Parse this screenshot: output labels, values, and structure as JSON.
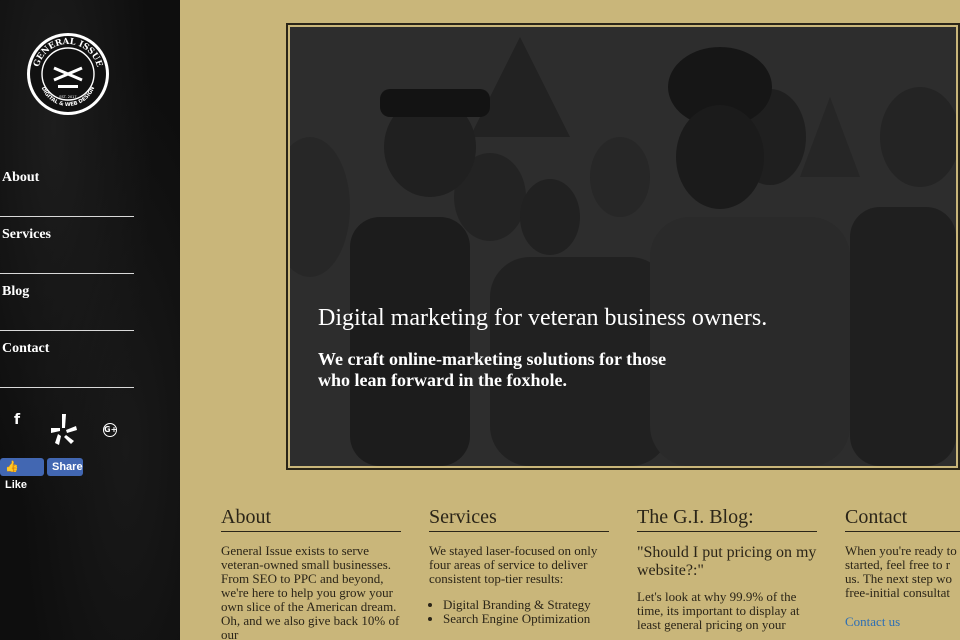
{
  "brand": {
    "logo_top_text": "GENERAL ISSUE",
    "logo_bottom_text": "DIGITAL & WEB DESIGN",
    "logo_est": "EST. 2017"
  },
  "nav": {
    "items": [
      "About",
      "Services",
      "Blog",
      "Contact"
    ]
  },
  "social": {
    "facebook_icon": "f",
    "yelp_icon": "yelp-icon",
    "gplus_icon": "G+"
  },
  "fb": {
    "like_label": "Like",
    "share_label": "Share"
  },
  "hero": {
    "title": "Digital marketing for veteran business owners.",
    "subtitle_line1": "We craft online-marketing solutions for those",
    "subtitle_line2": "who lean forward in the foxhole."
  },
  "about": {
    "heading": "About",
    "text": "General Issue exists to serve veteran-owned small businesses. From SEO to PPC and beyond, we're here to help you grow your own slice of the American dream. Oh, and we also give back 10% of our"
  },
  "services": {
    "heading": "Services",
    "text": "We stayed laser-focused on only four areas of service to deliver consistent top-tier results:",
    "items": [
      "Digital Branding & Strategy",
      "Search Engine Optimization"
    ]
  },
  "blog": {
    "heading": "The G.I. Blog:",
    "question": "\"Should I put pricing on my website?:\"",
    "text": "Let's look at why 99.9% of the time, its important to display at least general pricing on your"
  },
  "contact": {
    "heading": "Contact",
    "line1": "When you're ready to",
    "line2": "started, feel free to r",
    "line3": "us. The next step wo",
    "line4": "free-initial consultat",
    "link": "Contact us"
  },
  "colors": {
    "background": "#c9b67a",
    "sidebar": "#0e0e0e",
    "text": "#2b2518",
    "link": "#2c6eb5",
    "facebook": "#4267b2"
  }
}
